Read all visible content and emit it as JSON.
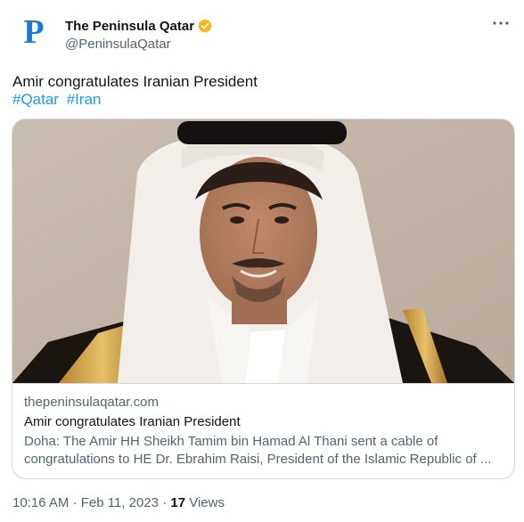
{
  "author": {
    "display_name": "The Peninsula Qatar",
    "handle": "@PeninsulaQatar",
    "avatar_letter": "P",
    "verified": true,
    "verified_badge_color": "#f4b41a"
  },
  "tweet": {
    "text": "Amir congratulates Iranian President",
    "hashtags": [
      "#Qatar",
      "#Iran"
    ]
  },
  "link_card": {
    "image_icon": "portrait-photo",
    "domain": "thepeninsulaqatar.com",
    "title": "Amir congratulates Iranian President",
    "description_line1": "Doha: The Amir HH Sheikh Tamim bin Hamad Al Thani sent a cable of",
    "description_line2": "congratulations to HE Dr. Ebrahim Raisi, President of the Islamic Republic of ..."
  },
  "meta": {
    "time": "10:16 AM",
    "separator1": " · ",
    "date": "Feb 11, 2023",
    "separator2": " · ",
    "views_count": "17",
    "views_label": " Views"
  },
  "colors": {
    "link": "#1d9bf0",
    "secondary_text": "#536471",
    "brand_blue": "#1d7ad3"
  }
}
